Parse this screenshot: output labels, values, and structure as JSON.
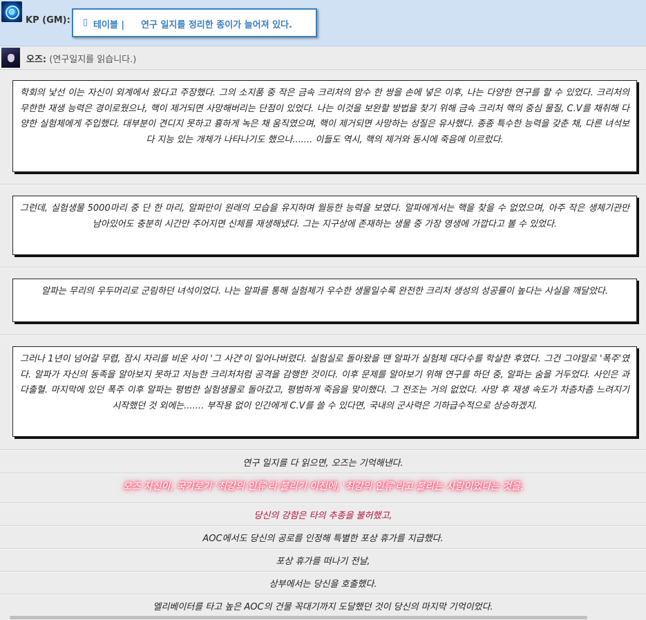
{
  "gm": {
    "name": "KP (GM):",
    "box_icon": "▯",
    "box_tag": "테이블 |",
    "box_text": "연구 일지를 정리한 종이가 늘어져 있다."
  },
  "oz": {
    "name": "오즈:",
    "action": "(연구일지를 읽습니다.)"
  },
  "cards": [
    "학회의 낯선 이는 자신이 외계에서 왔다고 주장했다. 그의 소지품 중 작은 금속 크리처의 암수 한 쌍을 손에 넣은 이후, 나는 다양한 연구를 할 수 있었다. 크리처의 무한한 재생 능력은 경이로웠으나, 핵이 제거되면 사망해버리는 단점이 있었다. 나는 이것을 보완할 방법을 찾기 위해 금속 크리처 핵의 중심 물질, C.V를 채취해 다양한 실험체에게 주입했다. 대부분이 견디지 못하고 흉하게 녹은 채 움직였으며, 핵이 제거되면 사망하는 성질은 유사했다. 종종 특수한 능력을 갖춘 채, 다른 녀석보다 지능 있는 개체가 나타나기도 했으나....... 이들도 역시, 핵의 제거와 동시에 죽음에 이르렀다.",
    "그런데, 실험생물 5000마리 중 단 한 마리, 알파만이 원래의 모습을 유지하며 월등한 능력을 보였다. 알파에게서는 핵을 찾을 수 없었으며, 아주 작은 생체기관만 남아있어도 충분히 시간만 주어지면 신체를 재생해냈다. 그는 지구상에 존재하는 생물 중 가장 영생에 가깝다고 볼 수 있었다.",
    "알파는 무리의 우두머리로 군림하던 녀석이었다. 나는 알파를 통해 실험체가 우수한 생물일수록 완전한 크리처 생성의 성공률이 높다는 사실을 깨달았다.",
    "그러나 1년이 넘어갈 무렵, 잠시 자리를 비운 사이 '그 사건'이 일어나버렸다. 실험실로 돌아왔을 땐 알파가 실험체 대다수를 학살한 후였다. 그건 그야말로 '폭주'였다. 알파가 자신의 동족을 알아보지 못하고 저능한 크리처처럼 공격을 감행한 것이다. 이후 문제를 알아보기 위해 연구를 하던 중, 알파는 숨을 거두었다. 사인은 과다출혈. 마지막에 있던 폭주 이후 알파는 평범한 실험생물로 돌아갔고, 평범하게 죽음을 맞이했다. 그 전조는 거의 없었다. 사망 후 재생 속도가 차츰차츰 느려지기 시작했던 것 외에는....... 부작용 없이 인간에게 C.V를 쓸 수 있다면, 국내의 군사력은 기하급수적으로 상승하겠지."
  ],
  "narration": [
    "연구 일지를 다 읽으면, 오즈는 기억해낸다.",
    "오즈 자신이, 국가로가 '최강의 인류'라 불리기 이전에, '최강의 인류'라고 불리는 사람이었다는 것을.",
    "당신의 강함은 타의 추종을 불허했고,",
    "AOC에서도 당신의 공로를 인정해 특별한 포상 휴가를 지급했다.",
    "포상 휴가를 떠나기 전날,",
    "상부에서는 당신을 호출했다.",
    "엘리베이터를 타고 높은 AOC의 건물 꼭대기까지 도달했던 것이 당신의 마지막 기억이었다."
  ],
  "colors": {
    "gm_row_bg": "#cfe1f2",
    "gm_box_border": "#3a7fc1",
    "glow": "#ff2f5b",
    "crimson_text": "#b3123c"
  }
}
